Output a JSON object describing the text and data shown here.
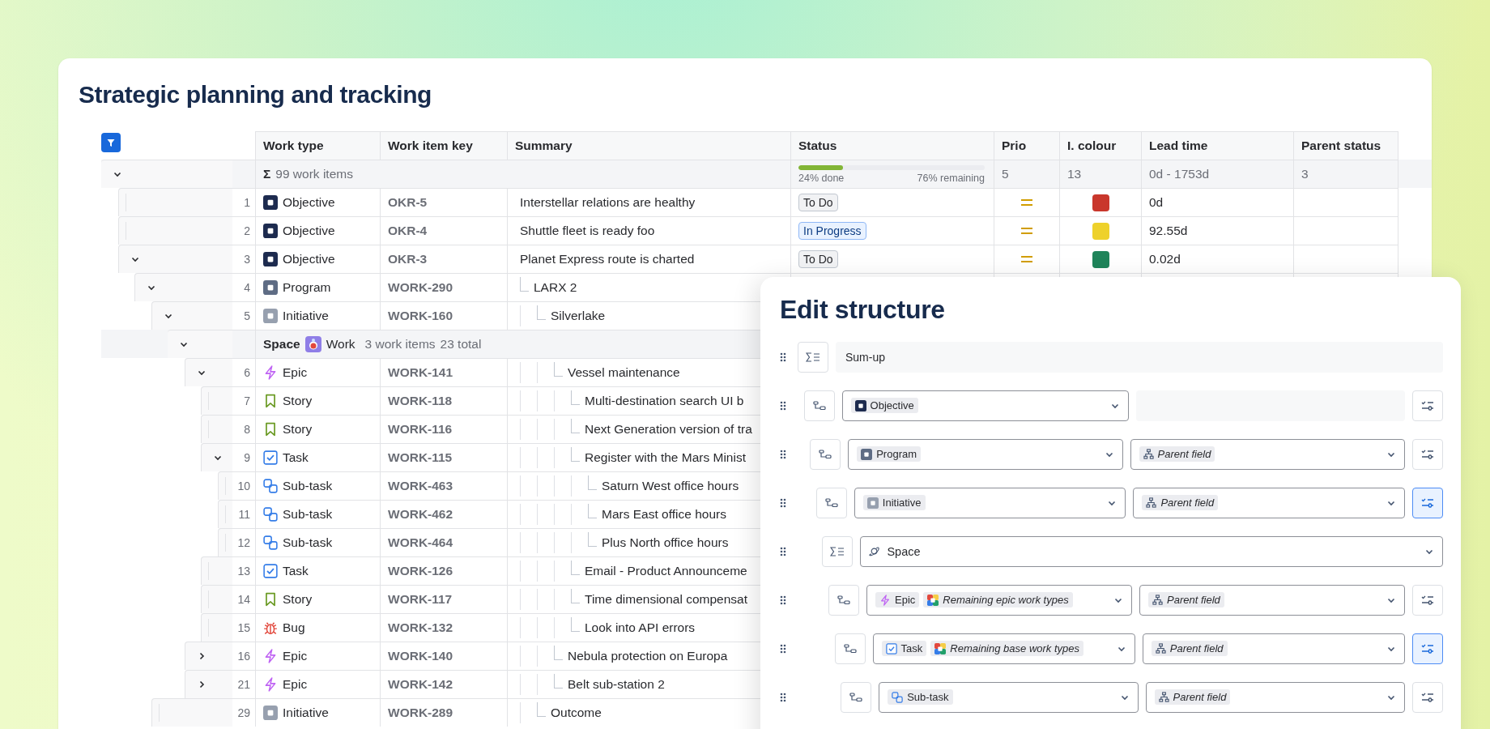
{
  "title": "Strategic planning and tracking",
  "table": {
    "columns": [
      "Work type",
      "Work item key",
      "Summary",
      "Status",
      "Prio",
      "I. colour",
      "Lead time",
      "Parent status"
    ],
    "rows": [
      {
        "kind": "total",
        "expanded": true,
        "sigma": "Σ",
        "label": "99 work items",
        "progress": {
          "level": 0.24,
          "done": "24% done",
          "remaining": "76% remaining"
        },
        "prio": "5",
        "colour": "13",
        "lead_time": "0d - 1753d",
        "parent_status": "3",
        "children": [
          {
            "kind": "item",
            "num": "1",
            "work_type": {
              "kind": "objective",
              "label": "Objective"
            },
            "key": "OKR-5",
            "summary": "Interstellar relations are healthy",
            "status": {
              "label": "To Do",
              "kind": "todo"
            },
            "priority": {
              "kind": "medium"
            },
            "color": "#c9372c",
            "lead_time": "0d"
          },
          {
            "kind": "item",
            "num": "2",
            "work_type": {
              "kind": "objective",
              "label": "Objective"
            },
            "key": "OKR-4",
            "summary": "Shuttle fleet is ready foo",
            "status": {
              "label": "In Progress",
              "kind": "inprogress"
            },
            "priority": {
              "kind": "medium"
            },
            "color": "#eed12b",
            "lead_time": "92.55d"
          },
          {
            "kind": "item",
            "num": "3",
            "work_type": {
              "kind": "objective",
              "label": "Objective"
            },
            "key": "OKR-3",
            "summary": "Planet Express route is charted",
            "status": {
              "label": "To Do",
              "kind": "todo"
            },
            "priority": {
              "kind": "medium"
            },
            "color": "#1f845a",
            "lead_time": "0.02d",
            "expanded": true,
            "children": [
              {
                "kind": "item",
                "num": "4",
                "work_type": {
                  "kind": "program",
                  "label": "Program"
                },
                "key": "WORK-290",
                "summary": "LARX 2",
                "expanded": true,
                "children": [
                  {
                    "kind": "item",
                    "num": "5",
                    "work_type": {
                      "kind": "initiative",
                      "label": "Initiative"
                    },
                    "key": "WORK-160",
                    "summary": "Silverlake",
                    "expanded": true,
                    "children": [
                      {
                        "kind": "group",
                        "field": "Space",
                        "value": "Work",
                        "count": "3 work items",
                        "total": "23 total",
                        "expanded": true,
                        "children": [
                          {
                            "kind": "item",
                            "num": "6",
                            "work_type": {
                              "kind": "epic",
                              "label": "Epic"
                            },
                            "key": "WORK-141",
                            "summary": "Vessel maintenance",
                            "expanded": true,
                            "children": [
                              {
                                "kind": "item",
                                "num": "7",
                                "work_type": {
                                  "kind": "story",
                                  "label": "Story"
                                },
                                "key": "WORK-118",
                                "summary": "Multi-destination search UI b"
                              },
                              {
                                "kind": "item",
                                "num": "8",
                                "work_type": {
                                  "kind": "story",
                                  "label": "Story"
                                },
                                "key": "WORK-116",
                                "summary": "Next Generation version of tra"
                              },
                              {
                                "kind": "item",
                                "num": "9",
                                "work_type": {
                                  "kind": "task",
                                  "label": "Task"
                                },
                                "key": "WORK-115",
                                "summary": "Register with the Mars Minist",
                                "expanded": true,
                                "children": [
                                  {
                                    "kind": "item",
                                    "num": "10",
                                    "work_type": {
                                      "kind": "subtask",
                                      "label": "Sub-task"
                                    },
                                    "key": "WORK-463",
                                    "summary": "Saturn West office hours"
                                  },
                                  {
                                    "kind": "item",
                                    "num": "11",
                                    "work_type": {
                                      "kind": "subtask",
                                      "label": "Sub-task"
                                    },
                                    "key": "WORK-462",
                                    "summary": "Mars East office hours"
                                  },
                                  {
                                    "kind": "item",
                                    "num": "12",
                                    "work_type": {
                                      "kind": "subtask",
                                      "label": "Sub-task"
                                    },
                                    "key": "WORK-464",
                                    "summary": "Plus North office hours"
                                  }
                                ]
                              },
                              {
                                "kind": "item",
                                "num": "13",
                                "work_type": {
                                  "kind": "task",
                                  "label": "Task"
                                },
                                "key": "WORK-126",
                                "summary": "Email - Product Announceme"
                              },
                              {
                                "kind": "item",
                                "num": "14",
                                "work_type": {
                                  "kind": "story",
                                  "label": "Story"
                                },
                                "key": "WORK-117",
                                "summary": "Time dimensional compensat"
                              },
                              {
                                "kind": "item",
                                "num": "15",
                                "work_type": {
                                  "kind": "bug",
                                  "label": "Bug"
                                },
                                "key": "WORK-132",
                                "summary": "Look into API errors"
                              }
                            ]
                          },
                          {
                            "kind": "item",
                            "num": "16",
                            "work_type": {
                              "kind": "epic",
                              "label": "Epic"
                            },
                            "key": "WORK-140",
                            "summary": "Nebula protection on Europa",
                            "expanded": false
                          },
                          {
                            "kind": "item",
                            "num": "21",
                            "work_type": {
                              "kind": "epic",
                              "label": "Epic"
                            },
                            "key": "WORK-142",
                            "summary": "Belt sub-station 2",
                            "expanded": false
                          }
                        ]
                      }
                    ]
                  },
                  {
                    "kind": "item",
                    "num": "29",
                    "work_type": {
                      "kind": "initiative",
                      "label": "Initiative"
                    },
                    "key": "WORK-289",
                    "summary": "Outcome"
                  }
                ]
              }
            ]
          }
        ]
      }
    ]
  },
  "panel": {
    "title": "Edit structure",
    "rows": [
      {
        "kind": "sumup",
        "value": "Sum-up",
        "children": [
          {
            "kind": "level",
            "types": [
              {
                "kind": "objective",
                "label": "Objective"
              }
            ],
            "settings_active": false,
            "children": [
              {
                "kind": "level",
                "types": [
                  {
                    "kind": "program",
                    "label": "Program"
                  }
                ],
                "relation": "Parent field",
                "settings_active": false,
                "children": [
                  {
                    "kind": "level",
                    "types": [
                      {
                        "kind": "initiative",
                        "label": "Initiative"
                      }
                    ],
                    "relation": "Parent field",
                    "settings_active": true,
                    "children": [
                      {
                        "kind": "grouping",
                        "value": "Space",
                        "children": [
                          {
                            "kind": "level",
                            "types": [
                              {
                                "kind": "epic",
                                "label": "Epic"
                              },
                              {
                                "kind": "remaining",
                                "label": "Remaining epic work types"
                              }
                            ],
                            "relation": "Parent field",
                            "settings_active": false,
                            "children": [
                              {
                                "kind": "level",
                                "types": [
                                  {
                                    "kind": "task",
                                    "label": "Task"
                                  },
                                  {
                                    "kind": "remaining",
                                    "label": "Remaining base work types"
                                  }
                                ],
                                "relation": "Parent field",
                                "settings_active": true,
                                "children": [
                                  {
                                    "kind": "level",
                                    "types": [
                                      {
                                        "kind": "subtask",
                                        "label": "Sub-task"
                                      }
                                    ],
                                    "relation": "Parent field",
                                    "settings_active": false
                                  }
                                ]
                              }
                            ]
                          }
                        ]
                      }
                    ]
                  }
                ]
              }
            ]
          }
        ]
      }
    ]
  }
}
